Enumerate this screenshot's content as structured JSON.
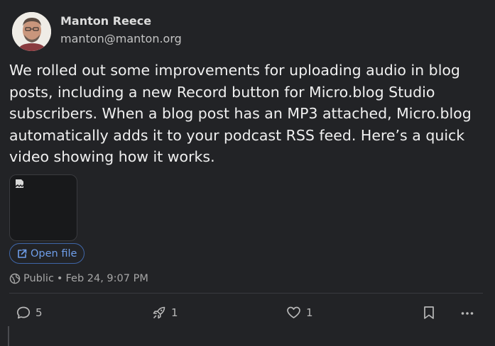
{
  "author": {
    "name": "Manton Reece",
    "handle": "manton@manton.org"
  },
  "post": {
    "text": "We rolled out some improvements for uploading audio in blog posts, including a new Record button for Micro.blog Studio subscribers. When a blog post has an MP3 attached, Micro.blog automatically adds it to your podcast RSS feed. Here’s a quick video showing how it works.",
    "open_file_label": "Open file",
    "visibility": "Public",
    "separator": "•",
    "timestamp": "Feb 24, 9:07 PM"
  },
  "actions": {
    "replies_count": "5",
    "boosts_count": "1",
    "likes_count": "1"
  },
  "colors": {
    "background": "#222326",
    "link": "#6f9eea",
    "link_border": "#3f66a8",
    "muted": "#a6a6a6"
  },
  "icons": [
    "external-link-icon",
    "globe-icon",
    "reply-icon",
    "rocket-icon",
    "heart-icon",
    "bookmark-icon",
    "more-icon",
    "broken-image-icon"
  ]
}
